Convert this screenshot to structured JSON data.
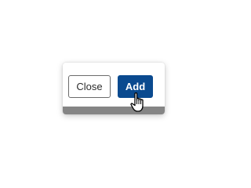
{
  "dialog": {
    "close_label": "Close",
    "add_label": "Add"
  },
  "colors": {
    "primary": "#0a4a8f",
    "footer_bar": "#858585",
    "close_border": "#6b6b6b"
  },
  "cursor": {
    "icon": "hand-pointer-icon"
  }
}
